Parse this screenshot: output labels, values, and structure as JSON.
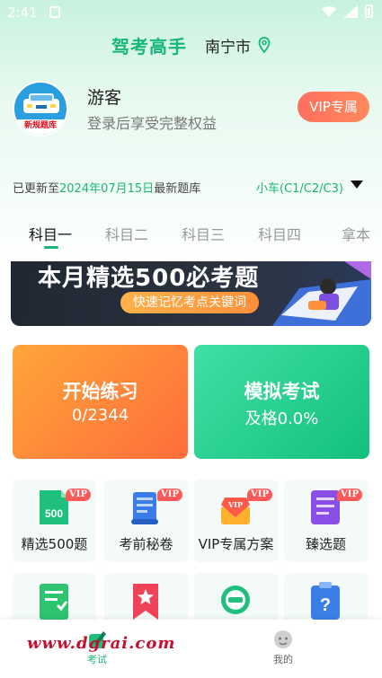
{
  "status_bar": {
    "time": "2:41"
  },
  "header": {
    "app_title": "驾考高手",
    "city": "南宁市"
  },
  "profile": {
    "avatar_tag": "新规题库",
    "name": "游客",
    "subtitle": "登录后享受完整权益",
    "vip_label": "VIP专属"
  },
  "update": {
    "prefix": "已更新至",
    "date": "2024年07月15日",
    "suffix": "最新题库",
    "car_type": "小车(C1/C2/C3)"
  },
  "tabs": [
    {
      "label": "科目一",
      "active": true
    },
    {
      "label": "科目二",
      "active": false
    },
    {
      "label": "科目三",
      "active": false
    },
    {
      "label": "科目四",
      "active": false
    },
    {
      "label": "拿本",
      "active": false
    }
  ],
  "banner": {
    "title_a": "本月精选",
    "title_num": "500",
    "title_b": "必考题",
    "subtitle": "快速记忆考点关键词"
  },
  "cards": {
    "practice": {
      "title": "开始练习",
      "value": "0/2344"
    },
    "exam": {
      "title": "模拟考试",
      "value": "及格0.0%"
    }
  },
  "features": [
    {
      "label": "精选500题",
      "vip": "VIP",
      "icon": "doc-500-icon"
    },
    {
      "label": "考前秘卷",
      "vip": "VIP",
      "icon": "scroll-icon"
    },
    {
      "label": "VIP专属方案",
      "vip": "VIP",
      "icon": "vip-diamond-icon"
    },
    {
      "label": "臻选题",
      "vip": "VIP",
      "icon": "list-doc-icon"
    }
  ],
  "features_row2": [
    {
      "icon": "checklist-icon"
    },
    {
      "icon": "bookmark-star-icon"
    },
    {
      "icon": "road-sign-icon"
    },
    {
      "icon": "question-clipboard-icon"
    }
  ],
  "bottom_nav": [
    {
      "label": "考试",
      "active": true
    },
    {
      "label": "我的",
      "active": false
    }
  ],
  "watermark": "www.dgrai.com",
  "colors": {
    "accent": "#18b779",
    "orange": "#ff7a3a",
    "vip_red": "#ff5a5a"
  }
}
